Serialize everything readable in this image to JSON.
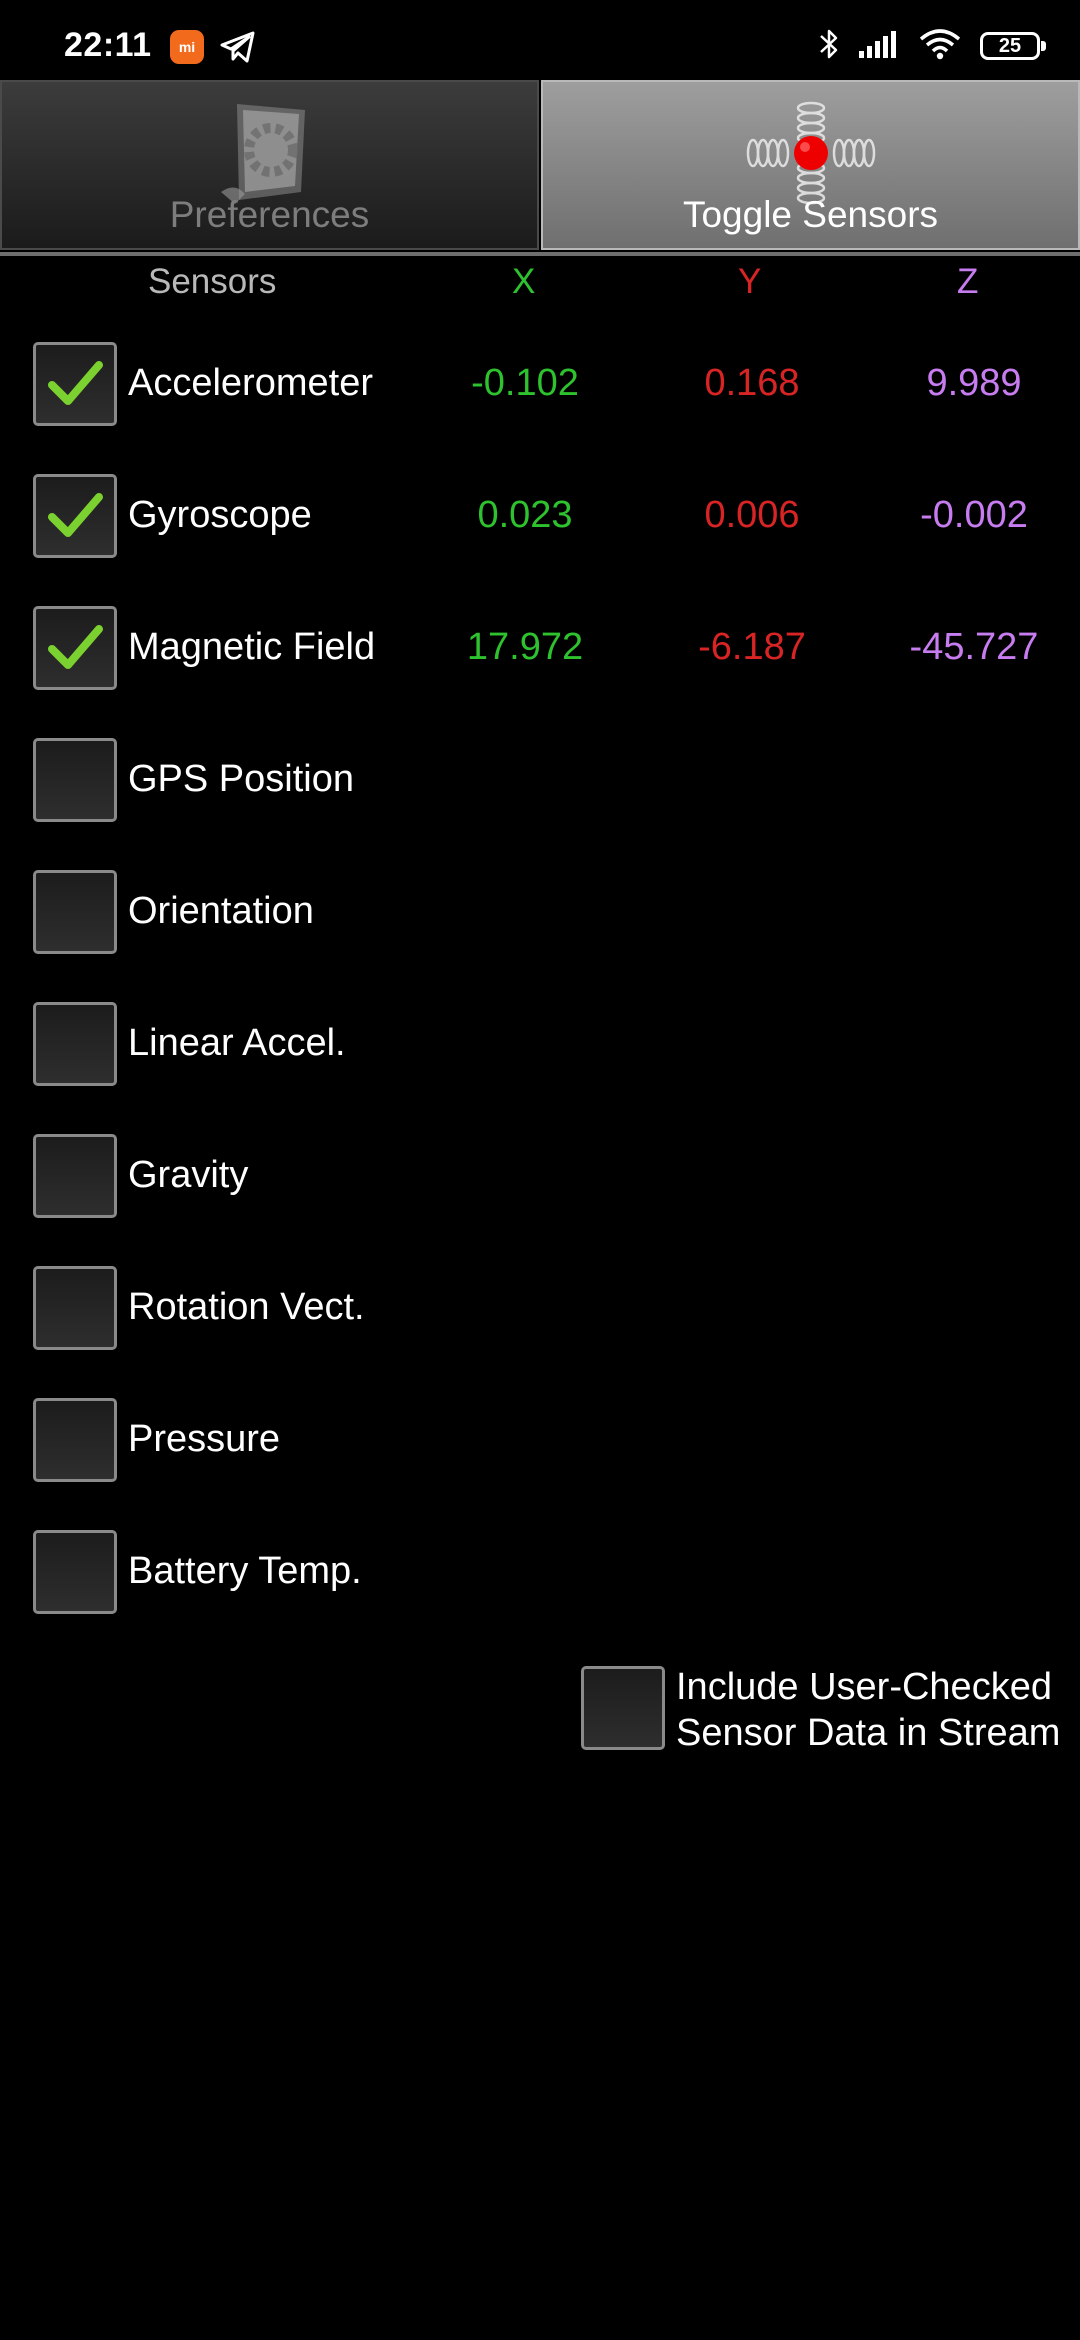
{
  "status_bar": {
    "time": "22:11",
    "mi_icon_label": "mi",
    "battery": "25",
    "icons": [
      "mi-app-icon",
      "telegram-icon",
      "bluetooth-icon",
      "signal-icon",
      "wifi-icon",
      "battery-icon"
    ]
  },
  "tabs": [
    {
      "label": "Preferences",
      "icon": "gear-page-icon",
      "selected": false
    },
    {
      "label": "Toggle Sensors",
      "icon": "sensor-axes-icon",
      "selected": true
    }
  ],
  "header": {
    "sensors": "Sensors",
    "x": "X",
    "y": "Y",
    "z": "Z"
  },
  "colors": {
    "x": "#2ec22e",
    "y": "#d82424",
    "z": "#c77cf0",
    "check": "#7bd12f"
  },
  "sensors": [
    {
      "label": "Accelerometer",
      "checked": true,
      "x": "-0.102",
      "y": "0.168",
      "z": "9.989"
    },
    {
      "label": "Gyroscope",
      "checked": true,
      "x": "0.023",
      "y": "0.006",
      "z": "-0.002"
    },
    {
      "label": "Magnetic Field",
      "checked": true,
      "x": "17.972",
      "y": "-6.187",
      "z": "-45.727"
    },
    {
      "label": "GPS Position",
      "checked": false,
      "x": "",
      "y": "",
      "z": ""
    },
    {
      "label": "Orientation",
      "checked": false,
      "x": "",
      "y": "",
      "z": ""
    },
    {
      "label": "Linear Accel.",
      "checked": false,
      "x": "",
      "y": "",
      "z": ""
    },
    {
      "label": "Gravity",
      "checked": false,
      "x": "",
      "y": "",
      "z": ""
    },
    {
      "label": "Rotation Vect.",
      "checked": false,
      "x": "",
      "y": "",
      "z": ""
    },
    {
      "label": "Pressure",
      "checked": false,
      "x": "",
      "y": "",
      "z": ""
    },
    {
      "label": "Battery Temp.",
      "checked": false,
      "x": "",
      "y": "",
      "z": ""
    }
  ],
  "include_option": {
    "line1": "Include User-Checked",
    "line2": "Sensor Data in Stream",
    "checked": false
  }
}
